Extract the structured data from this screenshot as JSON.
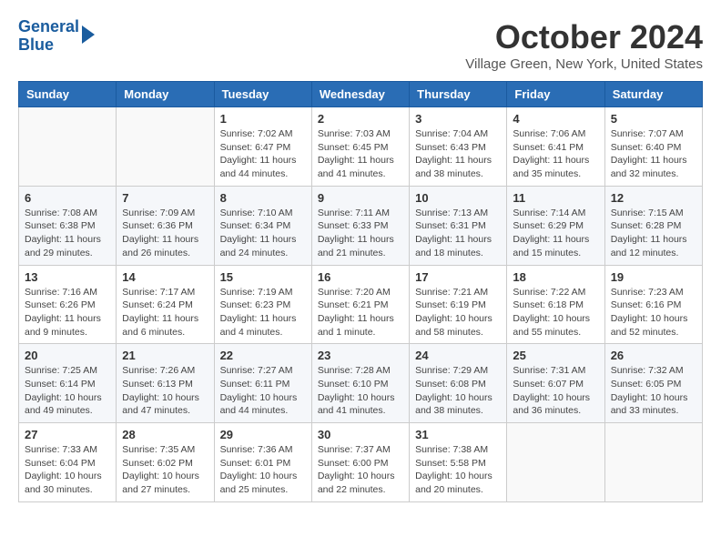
{
  "header": {
    "logo_line1": "General",
    "logo_line2": "Blue",
    "month_title": "October 2024",
    "subtitle": "Village Green, New York, United States"
  },
  "weekdays": [
    "Sunday",
    "Monday",
    "Tuesday",
    "Wednesday",
    "Thursday",
    "Friday",
    "Saturday"
  ],
  "weeks": [
    [
      {
        "day": "",
        "info": ""
      },
      {
        "day": "",
        "info": ""
      },
      {
        "day": "1",
        "info": "Sunrise: 7:02 AM\nSunset: 6:47 PM\nDaylight: 11 hours and 44 minutes."
      },
      {
        "day": "2",
        "info": "Sunrise: 7:03 AM\nSunset: 6:45 PM\nDaylight: 11 hours and 41 minutes."
      },
      {
        "day": "3",
        "info": "Sunrise: 7:04 AM\nSunset: 6:43 PM\nDaylight: 11 hours and 38 minutes."
      },
      {
        "day": "4",
        "info": "Sunrise: 7:06 AM\nSunset: 6:41 PM\nDaylight: 11 hours and 35 minutes."
      },
      {
        "day": "5",
        "info": "Sunrise: 7:07 AM\nSunset: 6:40 PM\nDaylight: 11 hours and 32 minutes."
      }
    ],
    [
      {
        "day": "6",
        "info": "Sunrise: 7:08 AM\nSunset: 6:38 PM\nDaylight: 11 hours and 29 minutes."
      },
      {
        "day": "7",
        "info": "Sunrise: 7:09 AM\nSunset: 6:36 PM\nDaylight: 11 hours and 26 minutes."
      },
      {
        "day": "8",
        "info": "Sunrise: 7:10 AM\nSunset: 6:34 PM\nDaylight: 11 hours and 24 minutes."
      },
      {
        "day": "9",
        "info": "Sunrise: 7:11 AM\nSunset: 6:33 PM\nDaylight: 11 hours and 21 minutes."
      },
      {
        "day": "10",
        "info": "Sunrise: 7:13 AM\nSunset: 6:31 PM\nDaylight: 11 hours and 18 minutes."
      },
      {
        "day": "11",
        "info": "Sunrise: 7:14 AM\nSunset: 6:29 PM\nDaylight: 11 hours and 15 minutes."
      },
      {
        "day": "12",
        "info": "Sunrise: 7:15 AM\nSunset: 6:28 PM\nDaylight: 11 hours and 12 minutes."
      }
    ],
    [
      {
        "day": "13",
        "info": "Sunrise: 7:16 AM\nSunset: 6:26 PM\nDaylight: 11 hours and 9 minutes."
      },
      {
        "day": "14",
        "info": "Sunrise: 7:17 AM\nSunset: 6:24 PM\nDaylight: 11 hours and 6 minutes."
      },
      {
        "day": "15",
        "info": "Sunrise: 7:19 AM\nSunset: 6:23 PM\nDaylight: 11 hours and 4 minutes."
      },
      {
        "day": "16",
        "info": "Sunrise: 7:20 AM\nSunset: 6:21 PM\nDaylight: 11 hours and 1 minute."
      },
      {
        "day": "17",
        "info": "Sunrise: 7:21 AM\nSunset: 6:19 PM\nDaylight: 10 hours and 58 minutes."
      },
      {
        "day": "18",
        "info": "Sunrise: 7:22 AM\nSunset: 6:18 PM\nDaylight: 10 hours and 55 minutes."
      },
      {
        "day": "19",
        "info": "Sunrise: 7:23 AM\nSunset: 6:16 PM\nDaylight: 10 hours and 52 minutes."
      }
    ],
    [
      {
        "day": "20",
        "info": "Sunrise: 7:25 AM\nSunset: 6:14 PM\nDaylight: 10 hours and 49 minutes."
      },
      {
        "day": "21",
        "info": "Sunrise: 7:26 AM\nSunset: 6:13 PM\nDaylight: 10 hours and 47 minutes."
      },
      {
        "day": "22",
        "info": "Sunrise: 7:27 AM\nSunset: 6:11 PM\nDaylight: 10 hours and 44 minutes."
      },
      {
        "day": "23",
        "info": "Sunrise: 7:28 AM\nSunset: 6:10 PM\nDaylight: 10 hours and 41 minutes."
      },
      {
        "day": "24",
        "info": "Sunrise: 7:29 AM\nSunset: 6:08 PM\nDaylight: 10 hours and 38 minutes."
      },
      {
        "day": "25",
        "info": "Sunrise: 7:31 AM\nSunset: 6:07 PM\nDaylight: 10 hours and 36 minutes."
      },
      {
        "day": "26",
        "info": "Sunrise: 7:32 AM\nSunset: 6:05 PM\nDaylight: 10 hours and 33 minutes."
      }
    ],
    [
      {
        "day": "27",
        "info": "Sunrise: 7:33 AM\nSunset: 6:04 PM\nDaylight: 10 hours and 30 minutes."
      },
      {
        "day": "28",
        "info": "Sunrise: 7:35 AM\nSunset: 6:02 PM\nDaylight: 10 hours and 27 minutes."
      },
      {
        "day": "29",
        "info": "Sunrise: 7:36 AM\nSunset: 6:01 PM\nDaylight: 10 hours and 25 minutes."
      },
      {
        "day": "30",
        "info": "Sunrise: 7:37 AM\nSunset: 6:00 PM\nDaylight: 10 hours and 22 minutes."
      },
      {
        "day": "31",
        "info": "Sunrise: 7:38 AM\nSunset: 5:58 PM\nDaylight: 10 hours and 20 minutes."
      },
      {
        "day": "",
        "info": ""
      },
      {
        "day": "",
        "info": ""
      }
    ]
  ]
}
